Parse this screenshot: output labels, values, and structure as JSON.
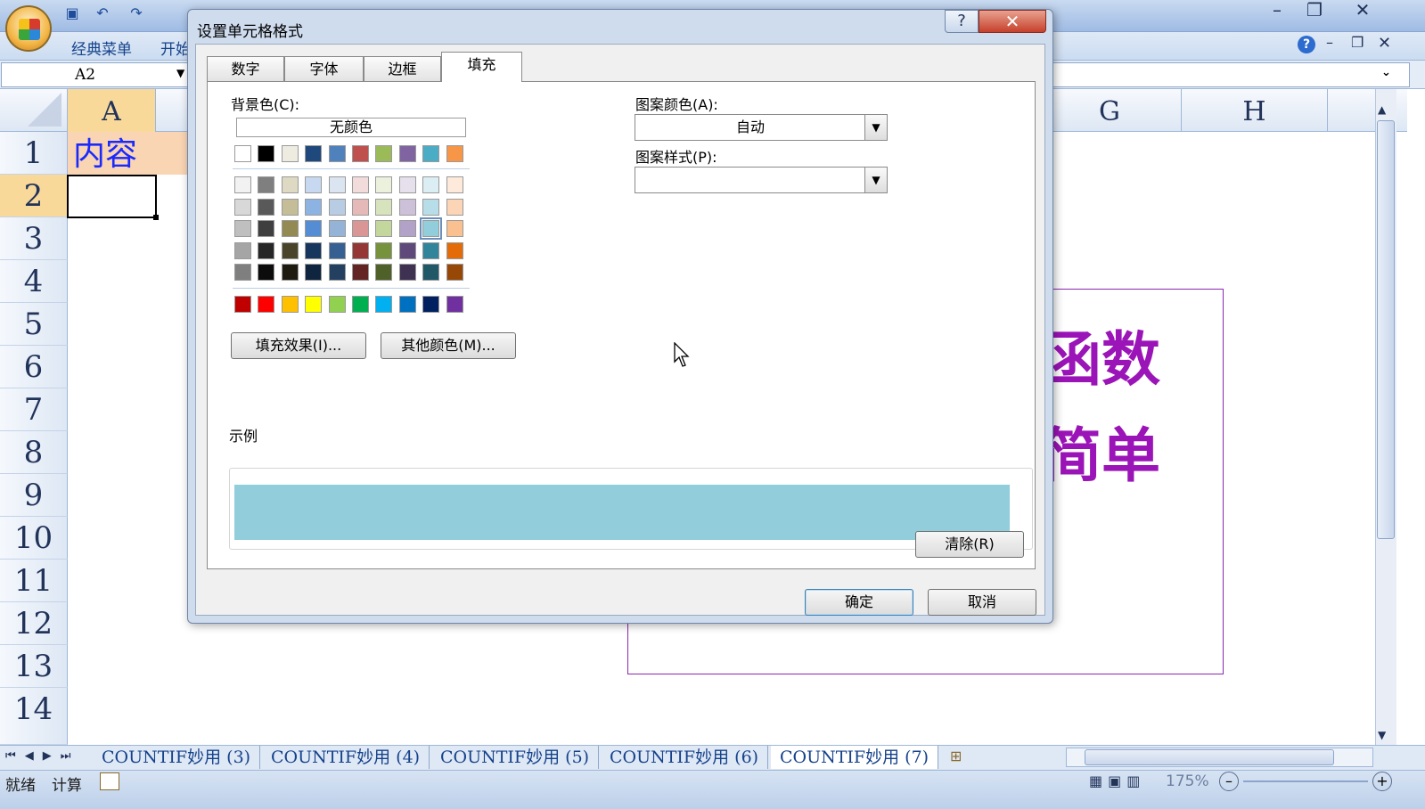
{
  "app": {
    "menu_tabs": [
      "经典菜单",
      "开始"
    ]
  },
  "formula_bar": {
    "name_box": "A2"
  },
  "grid": {
    "columns": [
      "A",
      "G",
      "H"
    ],
    "rows": [
      "1",
      "2",
      "3",
      "4",
      "5",
      "6",
      "7",
      "8",
      "9",
      "10",
      "11",
      "12",
      "13",
      "14"
    ],
    "cell_A1": "内容",
    "shape_line1": "函数",
    "shape_line2": "简单"
  },
  "sheet_tabs": [
    "COUNTIF妙用 (3)",
    "COUNTIF妙用 (4)",
    "COUNTIF妙用 (5)",
    "COUNTIF妙用 (6)",
    "COUNTIF妙用 (7)"
  ],
  "status": {
    "ready": "就绪",
    "calc": "计算",
    "zoom": "175%"
  },
  "dialog": {
    "title": "设置单元格格式",
    "help": "?",
    "close": "✕",
    "tabs": [
      "数字",
      "字体",
      "边框",
      "填充"
    ],
    "active_tab": "填充",
    "background_label": "背景色(C):",
    "no_color": "无颜色",
    "pattern_color_label": "图案颜色(A):",
    "pattern_color_value": "自动",
    "pattern_style_label": "图案样式(P):",
    "pattern_style_value": "",
    "fill_effects": "填充效果(I)...",
    "more_colors": "其他颜色(M)...",
    "sample_label": "示例",
    "sample_color": "#92cddc",
    "clear": "清除(R)",
    "ok": "确定",
    "cancel": "取消",
    "theme_row": [
      "#ffffff",
      "#000000",
      "#eeece1",
      "#1f497d",
      "#4f81bd",
      "#c0504d",
      "#9bbb59",
      "#8064a2",
      "#4bacc6",
      "#f79646"
    ],
    "tint_rows": [
      [
        "#f2f2f2",
        "#7f7f7f",
        "#ddd9c3",
        "#c6d9f0",
        "#dbe5f1",
        "#f2dcdb",
        "#ebf1dd",
        "#e5e0ec",
        "#dbeef3",
        "#fdeada"
      ],
      [
        "#d8d8d8",
        "#595959",
        "#c4bd97",
        "#8db3e2",
        "#b8cce4",
        "#e5b9b7",
        "#d7e3bc",
        "#ccc1d9",
        "#b7dde8",
        "#fbd5b5"
      ],
      [
        "#bfbfbf",
        "#3f3f3f",
        "#938953",
        "#548dd4",
        "#95b3d7",
        "#d99694",
        "#c3d69b",
        "#b2a2c7",
        "#92cddc",
        "#fac08f"
      ],
      [
        "#a5a5a5",
        "#262626",
        "#494429",
        "#17365d",
        "#366092",
        "#953734",
        "#76923c",
        "#5f497a",
        "#31859b",
        "#e36c09"
      ],
      [
        "#7f7f7f",
        "#0c0c0c",
        "#1d1b10",
        "#0f243e",
        "#244061",
        "#632423",
        "#4f6128",
        "#3f3151",
        "#205867",
        "#974806"
      ]
    ],
    "standard_row": [
      "#c00000",
      "#ff0000",
      "#ffc000",
      "#ffff00",
      "#92d050",
      "#00b050",
      "#00b0f0",
      "#0070c0",
      "#002060",
      "#7030a0"
    ],
    "selected_swatch": "#92cddc"
  }
}
